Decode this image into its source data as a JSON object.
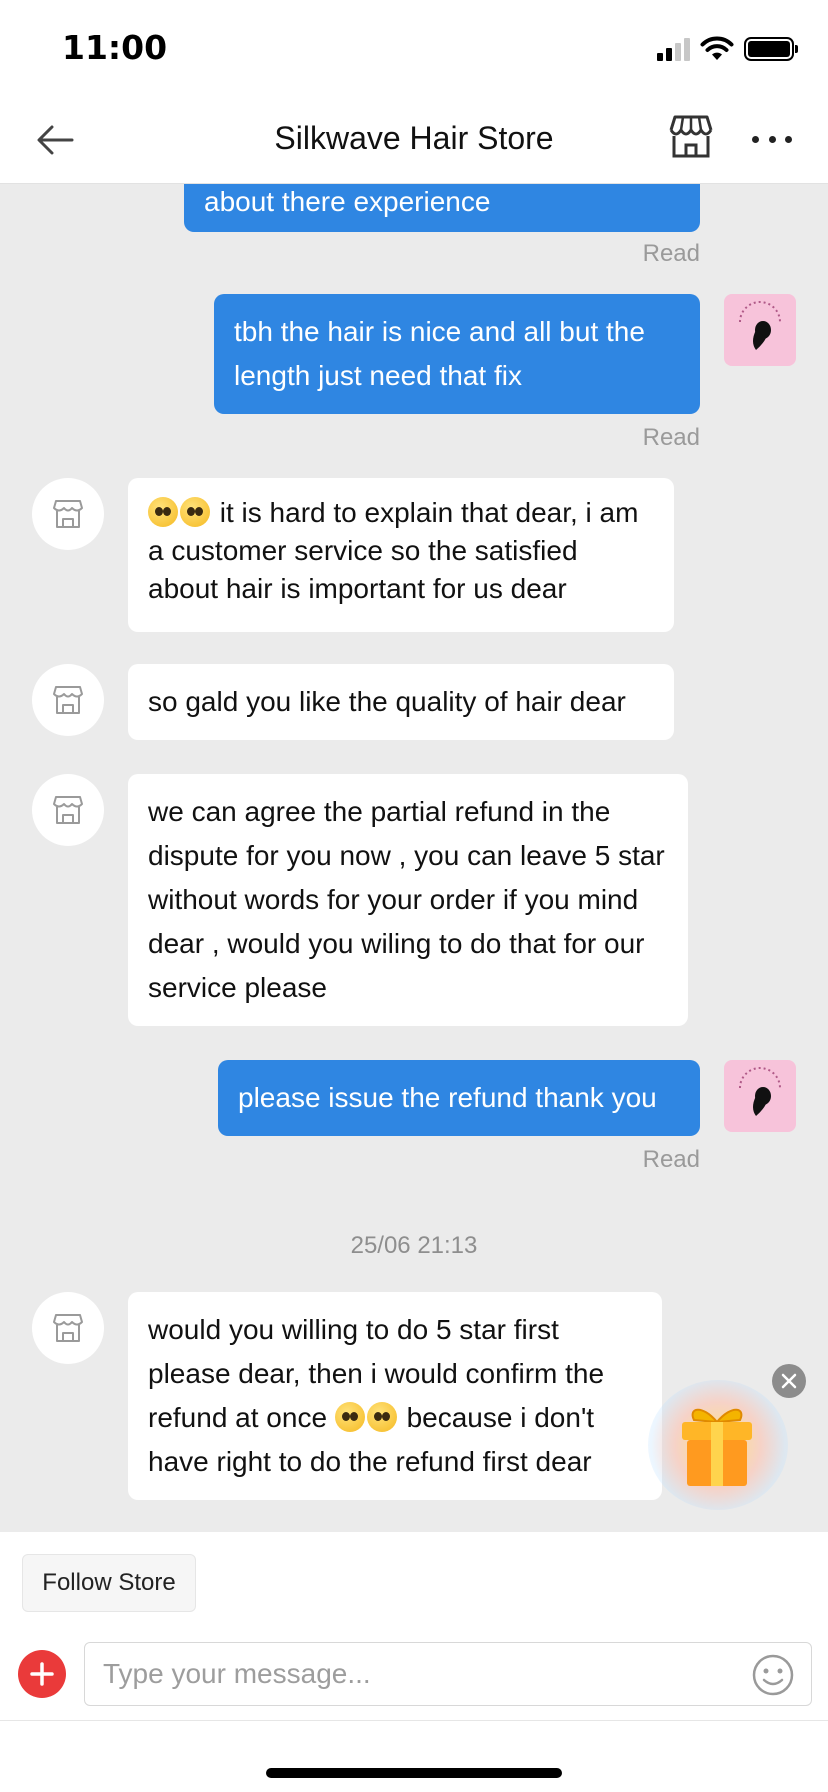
{
  "status_bar": {
    "time": "11:00"
  },
  "header": {
    "title": "Silkwave Hair Store"
  },
  "messages": [
    {
      "direction": "out",
      "text": "about there experience",
      "status": "Read"
    },
    {
      "direction": "out",
      "text": "tbh the hair is nice and all but the length just need that fix",
      "status": "Read"
    },
    {
      "direction": "in",
      "text_after_emoji": " it is hard to explain that dear, i am a customer service so the satisfied about hair is important for us dear"
    },
    {
      "direction": "in",
      "text": "so gald you like the quality of hair dear"
    },
    {
      "direction": "in",
      "text": "we can agree the partial refund in the dispute for you now , you can leave 5 star without words for your order if you mind dear , would you wiling to do that for our service please"
    },
    {
      "direction": "out",
      "text": "please issue the refund thank you",
      "status": "Read"
    },
    {
      "direction": "in",
      "text_before_emoji": "would you willing to do 5 star first please dear, then i would confirm the refund at once ",
      "text_after_emoji": " because i don't have right to do the refund first dear"
    }
  ],
  "timestamp": "25/06 21:13",
  "bottom_bar": {
    "follow_label": "Follow Store",
    "input_placeholder": "Type your message..."
  },
  "icons": {
    "back": "arrow-left-icon",
    "store": "storefront-icon",
    "more": "more-horizontal-icon",
    "plus": "plus-icon",
    "smile": "smiley-icon",
    "gift": "gift-icon",
    "close": "close-icon"
  },
  "colors": {
    "outgoing_bubble": "#2f86e2",
    "incoming_bubble": "#ffffff",
    "chat_background": "#ebebeb",
    "plus_button": "#ea3a3a",
    "user_avatar_bg": "#f7c3da"
  }
}
